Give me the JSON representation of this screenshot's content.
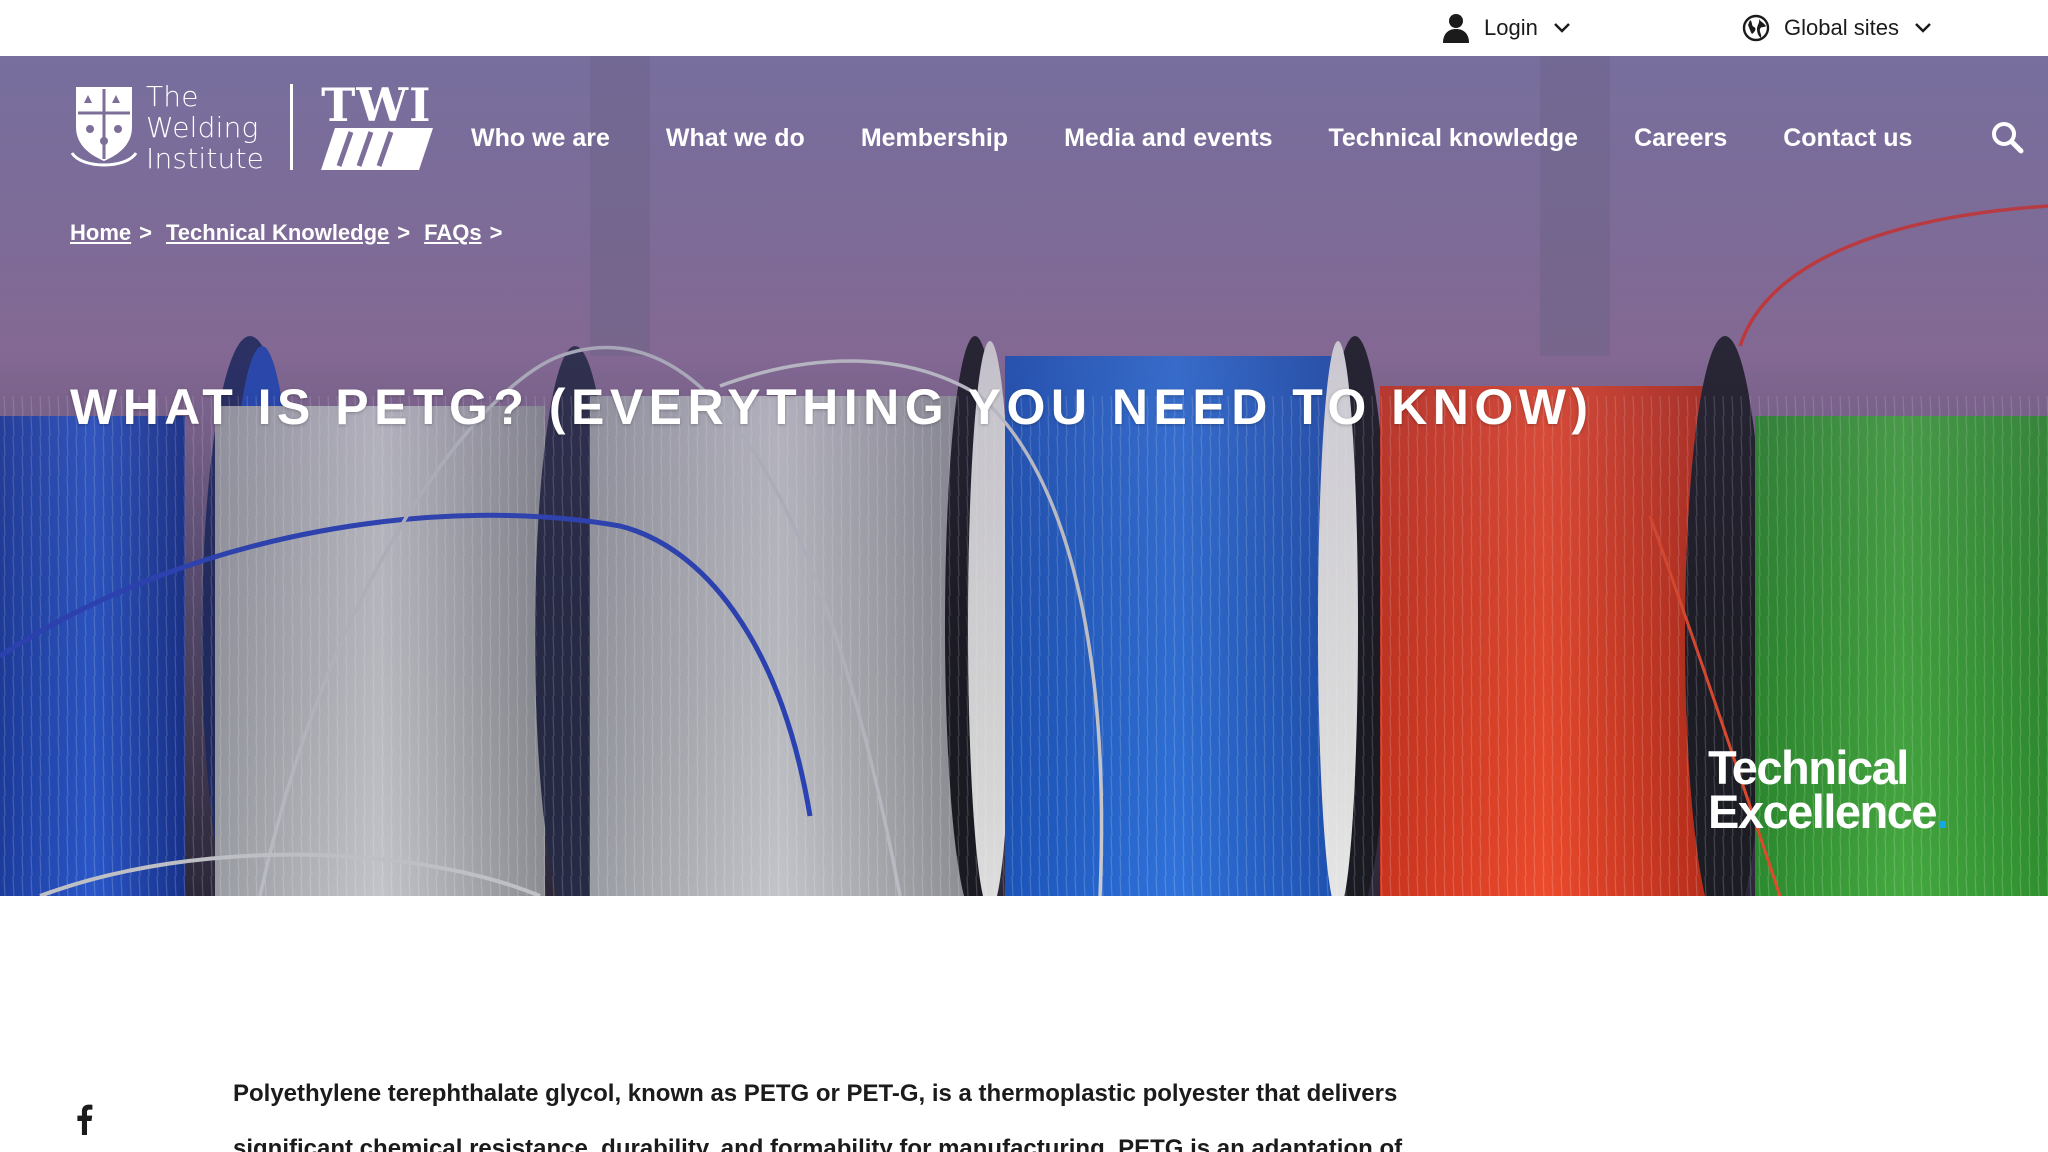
{
  "utility": {
    "login_label": "Login",
    "global_label": "Global sites"
  },
  "logo": {
    "text_lines": [
      "The",
      "Welding",
      "Institute"
    ],
    "brand": "TWI"
  },
  "nav": {
    "items": [
      {
        "label": "Who we are"
      },
      {
        "label": "What we do"
      },
      {
        "label": "Membership"
      },
      {
        "label": "Media and events"
      },
      {
        "label": "Technical knowledge"
      },
      {
        "label": "Careers"
      },
      {
        "label": "Contact us"
      }
    ]
  },
  "breadcrumb": {
    "items": [
      {
        "label": "Home"
      },
      {
        "label": "Technical Knowledge"
      },
      {
        "label": "FAQs"
      }
    ],
    "separator": ">"
  },
  "hero": {
    "title": "What is PETG? (Everything You Need To Know)",
    "badge_line1": "Technical",
    "badge_line2": "Excellence",
    "badge_dot": "."
  },
  "article": {
    "intro": "Polyethylene terephthalate glycol, known as PETG or PET-G, is a thermoplastic polyester that delivers significant chemical resistance, durability, and formability for manufacturing. PETG is an adaptation of"
  },
  "icons": {
    "login": "user-icon",
    "global": "globe-icon",
    "search": "search-icon",
    "social": "facebook-icon"
  },
  "colors": {
    "accent": "#16a8e0",
    "text": "#1b1b1b"
  }
}
